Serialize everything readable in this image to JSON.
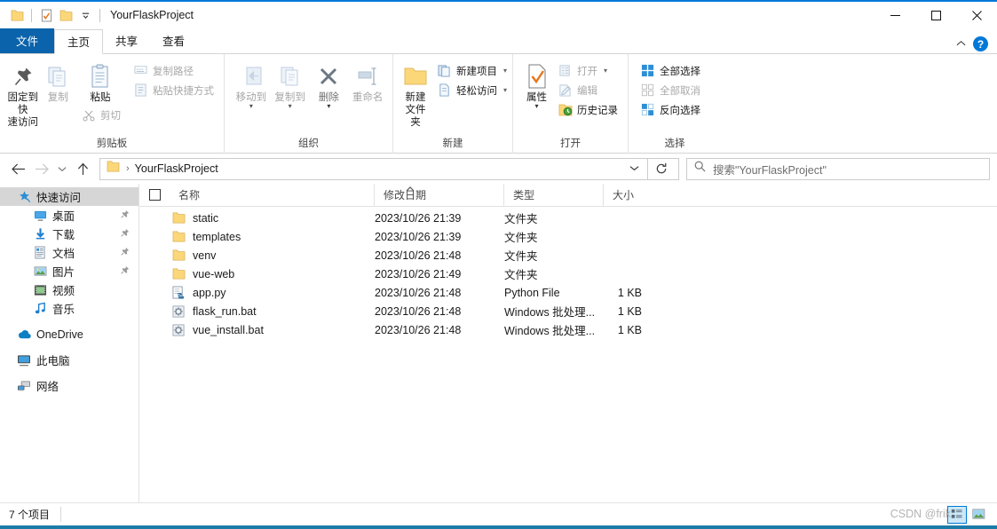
{
  "titlebar": {
    "title": "YourFlaskProject",
    "qat": [
      {
        "name": "folder-icon",
        "label": "文件夹"
      },
      {
        "name": "properties-icon",
        "label": "属性"
      },
      {
        "name": "new-folder-icon",
        "label": "新建文件夹"
      },
      {
        "name": "chevron-down-icon",
        "label": "自定义快速访问工具栏"
      }
    ],
    "controls": {
      "minimize": "—",
      "maximize": "☐",
      "close": "✕"
    }
  },
  "ribbon": {
    "tabs": [
      {
        "label": "文件",
        "state": "file"
      },
      {
        "label": "主页",
        "state": "active"
      },
      {
        "label": "共享",
        "state": "normal"
      },
      {
        "label": "查看",
        "state": "normal"
      }
    ],
    "collapse_icon": "chevron-up-icon",
    "help_label": "?",
    "groups": [
      {
        "label": "剪贴板",
        "big": [
          {
            "label": "固定到快\n速访问",
            "icon": "pin-icon",
            "disabled": false
          },
          {
            "label": "复制",
            "icon": "copy-icon",
            "disabled": true
          },
          {
            "label": "粘贴",
            "icon": "paste-icon",
            "disabled": false
          }
        ],
        "small_under_paste": [
          {
            "label": "剪切",
            "icon": "scissors-icon",
            "disabled": true
          }
        ],
        "small": [
          {
            "label": "复制路径",
            "icon": "copy-path-icon",
            "disabled": true
          },
          {
            "label": "粘贴快捷方式",
            "icon": "paste-shortcut-icon",
            "disabled": true
          }
        ]
      },
      {
        "label": "组织",
        "big": [
          {
            "label": "移动到",
            "icon": "move-to-icon",
            "disabled": true,
            "dropdown": true
          },
          {
            "label": "复制到",
            "icon": "copy-to-icon",
            "disabled": true,
            "dropdown": true
          },
          {
            "label": "删除",
            "icon": "delete-x-icon",
            "disabled": true,
            "dropdown": true
          },
          {
            "label": "重命名",
            "icon": "rename-icon",
            "disabled": true
          }
        ]
      },
      {
        "label": "新建",
        "big": [
          {
            "label": "新建\n文件夹",
            "icon": "new-folder-icon",
            "disabled": false
          }
        ],
        "small": [
          {
            "label": "新建项目",
            "icon": "new-item-icon",
            "disabled": false,
            "dropdown": true
          },
          {
            "label": "轻松访问",
            "icon": "easy-access-icon",
            "disabled": false,
            "dropdown": true
          }
        ]
      },
      {
        "label": "打开",
        "big": [
          {
            "label": "属性",
            "icon": "properties-icon",
            "disabled": false,
            "dropdown": true
          }
        ],
        "small": [
          {
            "label": "打开",
            "icon": "open-icon",
            "disabled": true,
            "dropdown": true
          },
          {
            "label": "编辑",
            "icon": "edit-icon",
            "disabled": true
          },
          {
            "label": "历史记录",
            "icon": "history-icon",
            "disabled": false
          }
        ]
      },
      {
        "label": "选择",
        "small": [
          {
            "label": "全部选择",
            "icon": "select-all-icon",
            "disabled": false
          },
          {
            "label": "全部取消",
            "icon": "select-none-icon",
            "disabled": true
          },
          {
            "label": "反向选择",
            "icon": "invert-selection-icon",
            "disabled": false
          }
        ]
      }
    ]
  },
  "addressbar": {
    "back_icon": "arrow-left-icon",
    "forward_icon": "arrow-right-icon",
    "recent_icon": "chevron-down-icon",
    "up_icon": "arrow-up-icon",
    "path_icon": "folder-icon",
    "path_separator": "›",
    "path_text": "YourFlaskProject",
    "path_dropdown_icon": "chevron-down-icon",
    "refresh_icon": "refresh-icon",
    "search_icon": "search-icon",
    "search_placeholder": "搜索\"YourFlaskProject\""
  },
  "sidebar": {
    "items": [
      {
        "label": "快速访问",
        "icon": "star-pin-icon",
        "level": 0,
        "selected": true,
        "pinned": false
      },
      {
        "label": "桌面",
        "icon": "desktop-icon",
        "level": 1,
        "selected": false,
        "pinned": true
      },
      {
        "label": "下载",
        "icon": "download-icon",
        "level": 1,
        "selected": false,
        "pinned": true
      },
      {
        "label": "文档",
        "icon": "documents-icon",
        "level": 1,
        "selected": false,
        "pinned": true
      },
      {
        "label": "图片",
        "icon": "pictures-icon",
        "level": 1,
        "selected": false,
        "pinned": true
      },
      {
        "label": "视频",
        "icon": "videos-icon",
        "level": 1,
        "selected": false,
        "pinned": false
      },
      {
        "label": "音乐",
        "icon": "music-icon",
        "level": 1,
        "selected": false,
        "pinned": false
      },
      {
        "label": "OneDrive",
        "icon": "onedrive-icon",
        "level": 0,
        "selected": false,
        "pinned": false,
        "gap_before": true
      },
      {
        "label": "此电脑",
        "icon": "this-pc-icon",
        "level": 0,
        "selected": false,
        "pinned": false,
        "gap_before": true
      },
      {
        "label": "网络",
        "icon": "network-icon",
        "level": 0,
        "selected": false,
        "pinned": false,
        "gap_before": true
      }
    ]
  },
  "filelist": {
    "columns": {
      "name": "名称",
      "date": "修改日期",
      "type": "类型",
      "size": "大小"
    },
    "sort_indicator": "ascending",
    "rows": [
      {
        "name": "static",
        "date": "2023/10/26 21:39",
        "type": "文件夹",
        "size": "",
        "icon": "folder-icon"
      },
      {
        "name": "templates",
        "date": "2023/10/26 21:39",
        "type": "文件夹",
        "size": "",
        "icon": "folder-icon"
      },
      {
        "name": "venv",
        "date": "2023/10/26 21:48",
        "type": "文件夹",
        "size": "",
        "icon": "folder-icon"
      },
      {
        "name": "vue-web",
        "date": "2023/10/26 21:49",
        "type": "文件夹",
        "size": "",
        "icon": "folder-icon"
      },
      {
        "name": "app.py",
        "date": "2023/10/26 21:48",
        "type": "Python File",
        "size": "1 KB",
        "icon": "python-file-icon"
      },
      {
        "name": "flask_run.bat",
        "date": "2023/10/26 21:48",
        "type": "Windows 批处理...",
        "size": "1 KB",
        "icon": "batch-file-icon"
      },
      {
        "name": "vue_install.bat",
        "date": "2023/10/26 21:48",
        "type": "Windows 批处理...",
        "size": "1 KB",
        "icon": "batch-file-icon"
      }
    ]
  },
  "statusbar": {
    "item_count": "7 个项目",
    "watermark": "CSDN @frik",
    "view_buttons": [
      {
        "name": "details-view-button",
        "active": true
      },
      {
        "name": "large-icons-view-button",
        "active": false
      }
    ]
  },
  "colors": {
    "accent": "#0078d7",
    "file_tab": "#0b63ab",
    "folder_yellow": "#fcd77a",
    "bottom_accent": "#1c7ca8",
    "selection": "#d6d6d6"
  }
}
